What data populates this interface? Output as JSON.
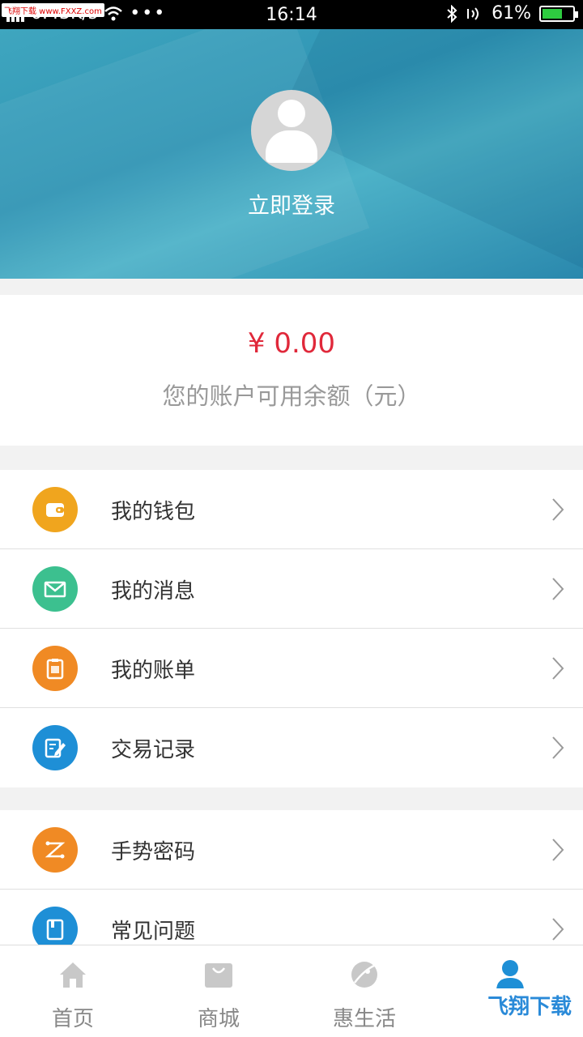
{
  "status_bar": {
    "speed": "0.43K/s",
    "time": "16:14",
    "battery": "61%"
  },
  "header": {
    "login_label": "立即登录"
  },
  "balance": {
    "amount": "¥ 0.00",
    "label": "您的账户可用余额（元）"
  },
  "menu_group1": [
    {
      "label": "我的钱包",
      "icon": "wallet-icon",
      "color": "#f0a51e"
    },
    {
      "label": "我的消息",
      "icon": "mail-icon",
      "color": "#3cc08f"
    },
    {
      "label": "我的账单",
      "icon": "clipboard-icon",
      "color": "#f08a24"
    },
    {
      "label": "交易记录",
      "icon": "edit-icon",
      "color": "#1e8fd6"
    }
  ],
  "menu_group2": [
    {
      "label": "手势密码",
      "icon": "gesture-icon",
      "color": "#f08a24"
    },
    {
      "label": "常见问题",
      "icon": "book-icon",
      "color": "#1e8fd6"
    }
  ],
  "tabbar": [
    {
      "label": "首页",
      "icon": "home-icon",
      "active": false
    },
    {
      "label": "商城",
      "icon": "shopping-bag-icon",
      "active": false
    },
    {
      "label": "惠生活",
      "icon": "planet-icon",
      "active": false
    },
    {
      "label": "",
      "icon": "person-icon",
      "active": true
    }
  ],
  "colors": {
    "accent": "#1e8fd6",
    "amount_red": "#e0283a"
  },
  "watermark": {
    "small": "飞翔下载 www.FXXZ.com",
    "large": "飞翔下载"
  }
}
